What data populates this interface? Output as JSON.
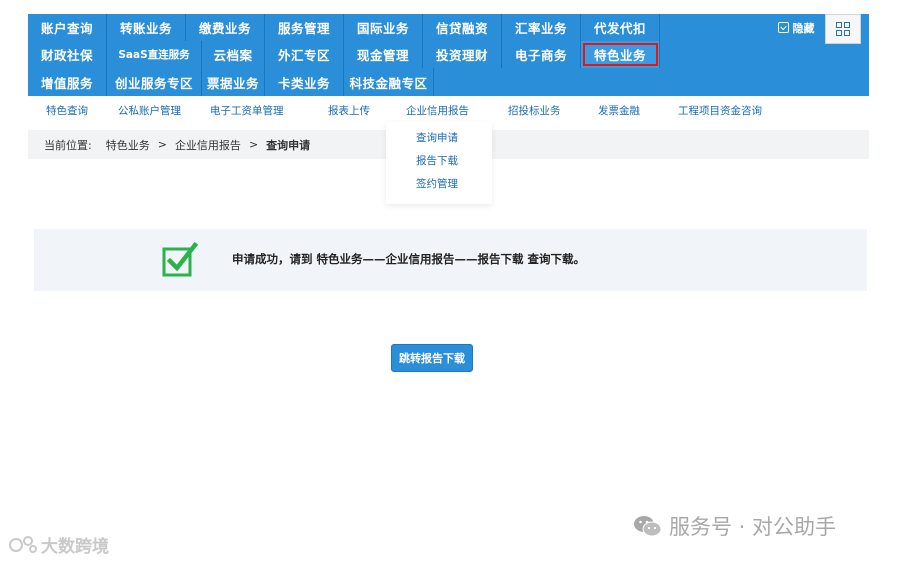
{
  "nav": {
    "row1": [
      "账户查询",
      "转账业务",
      "缴费业务",
      "服务管理",
      "国际业务",
      "信贷融资",
      "汇率业务",
      "代发代扣"
    ],
    "row2": [
      "财政社保",
      "SaaS直连服务",
      "云档案",
      "外汇专区",
      "现金管理",
      "投资理财",
      "电子商务",
      "特色业务"
    ],
    "row3": [
      "增值服务",
      "创业服务专区",
      "票据业务",
      "卡类业务",
      "科技金融专区"
    ],
    "hide_label": "隐藏"
  },
  "subnav": [
    "特色查询",
    "公私账户管理",
    "电子工资单管理",
    "报表上传",
    "企业信用报告",
    "招投标业务",
    "发票金融",
    "工程项目资金咨询"
  ],
  "breadcrumb": {
    "prefix": "当前位置:",
    "level1": "特色业务",
    "sep": ">",
    "level2": "企业信用报告",
    "current": "查询申请"
  },
  "dropdown": [
    "查询申请",
    "报告下载",
    "签约管理"
  ],
  "message": "申请成功，请到 特色业务——企业信用报告——报告下载 查询下载。",
  "jump_button": "跳转报告下载",
  "watermark_left": "大数跨境",
  "watermark_right": "服务号 · 对公助手",
  "colors": {
    "nav_blue": "#2b8ed8",
    "highlight_red": "#e01818",
    "check_green": "#2bb24c"
  }
}
